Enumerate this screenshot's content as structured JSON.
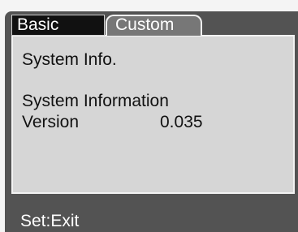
{
  "tabs": [
    {
      "label": "Basic",
      "selected": true
    },
    {
      "label": "Custom",
      "selected": false
    }
  ],
  "panel": {
    "title": "System Info.",
    "heading": "System Information",
    "rows": [
      {
        "label": "Version",
        "value": "0.035"
      }
    ]
  },
  "footer": {
    "hint": "Set:Exit"
  },
  "colors": {
    "screen_background": "#535353",
    "panel_background": "#d6d6d6",
    "selected_tab": "#111111",
    "inactive_tab": "#777777",
    "border": "#f2f2f2",
    "text_dark": "#111111",
    "text_light": "#ffffff"
  }
}
